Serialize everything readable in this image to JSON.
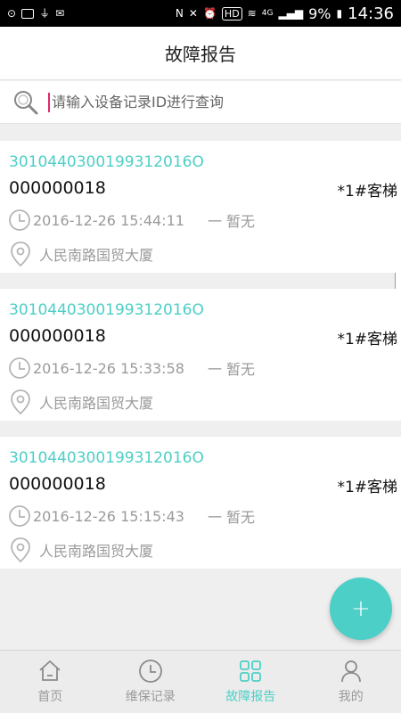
{
  "status_bar": {
    "battery_percent": "9%",
    "time": "14:36",
    "hd_label": "HD",
    "network_label": "4G"
  },
  "header": {
    "title": "故障报告"
  },
  "search": {
    "placeholder": "请输入设备记录ID进行查询",
    "value": ""
  },
  "records": [
    {
      "code": "3010440300199312016O",
      "id": "000000018",
      "unit": "*1#客梯",
      "time": "2016-12-26 15:44:11",
      "status": "一 暂无",
      "address": "人民南路国贸大厦"
    },
    {
      "code": "3010440300199312016O",
      "id": "000000018",
      "unit": "*1#客梯",
      "time": "2016-12-26 15:33:58",
      "status": "一 暂无",
      "address": "人民南路国贸大厦"
    },
    {
      "code": "3010440300199312016O",
      "id": "000000018",
      "unit": "*1#客梯",
      "time": "2016-12-26 15:15:43",
      "status": "一 暂无",
      "address": "人民南路国贸大厦"
    }
  ],
  "fab": {
    "label": "+"
  },
  "tabs": [
    {
      "label": "首页",
      "icon": "home-icon",
      "active": false
    },
    {
      "label": "维保记录",
      "icon": "clock-icon",
      "active": false
    },
    {
      "label": "故障报告",
      "icon": "grid-icon",
      "active": true
    },
    {
      "label": "我的",
      "icon": "user-icon",
      "active": false
    }
  ],
  "colors": {
    "accent": "#4ccfc6",
    "muted": "#9a9a9a",
    "cursor": "#e0286c"
  }
}
